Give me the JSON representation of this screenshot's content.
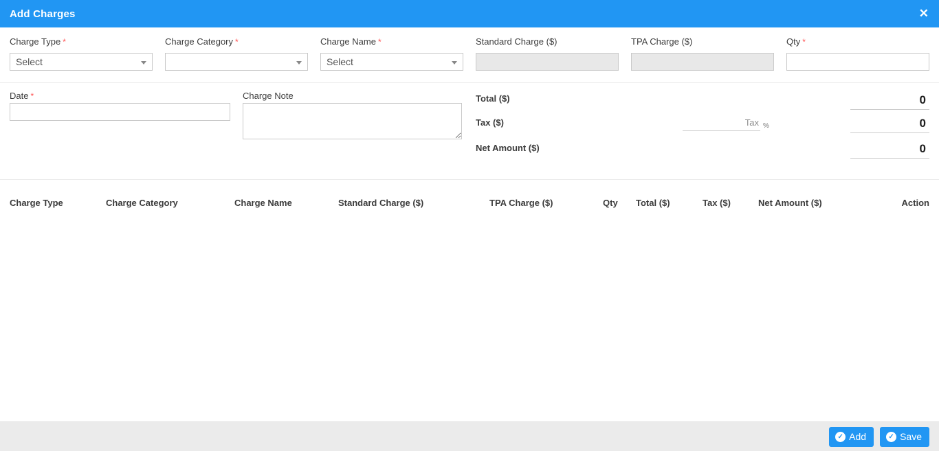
{
  "colors": {
    "accent": "#2196f3",
    "footer_bg": "#ebebeb",
    "required": "#ff5252"
  },
  "header": {
    "title": "Add Charges",
    "close_icon": "✕"
  },
  "required_marker": "*",
  "form": {
    "charge_type": {
      "label": "Charge Type",
      "value": "Select"
    },
    "charge_category": {
      "label": "Charge Category",
      "value": ""
    },
    "charge_name": {
      "label": "Charge Name",
      "value": "Select"
    },
    "standard_charge": {
      "label": "Standard Charge ($)",
      "value": ""
    },
    "tpa_charge": {
      "label": "TPA Charge ($)",
      "value": ""
    },
    "qty": {
      "label": "Qty",
      "value": ""
    },
    "date": {
      "label": "Date",
      "value": ""
    },
    "charge_note": {
      "label": "Charge Note",
      "value": ""
    },
    "total": {
      "label": "Total ($)",
      "value": "0"
    },
    "tax": {
      "label": "Tax ($)",
      "value": "0",
      "percent_input_placeholder": "Tax",
      "percent_suffix": "%"
    },
    "net_amount": {
      "label": "Net Amount ($)",
      "value": "0"
    }
  },
  "table": {
    "headers": [
      "Charge Type",
      "Charge Category",
      "Charge Name",
      "Standard Charge ($)",
      "TPA Charge ($)",
      "Qty",
      "Total ($)",
      "Tax ($)",
      "Net Amount ($)",
      "Action"
    ],
    "rows": []
  },
  "footer": {
    "add_label": "Add",
    "save_label": "Save",
    "check_icon": "✓"
  }
}
